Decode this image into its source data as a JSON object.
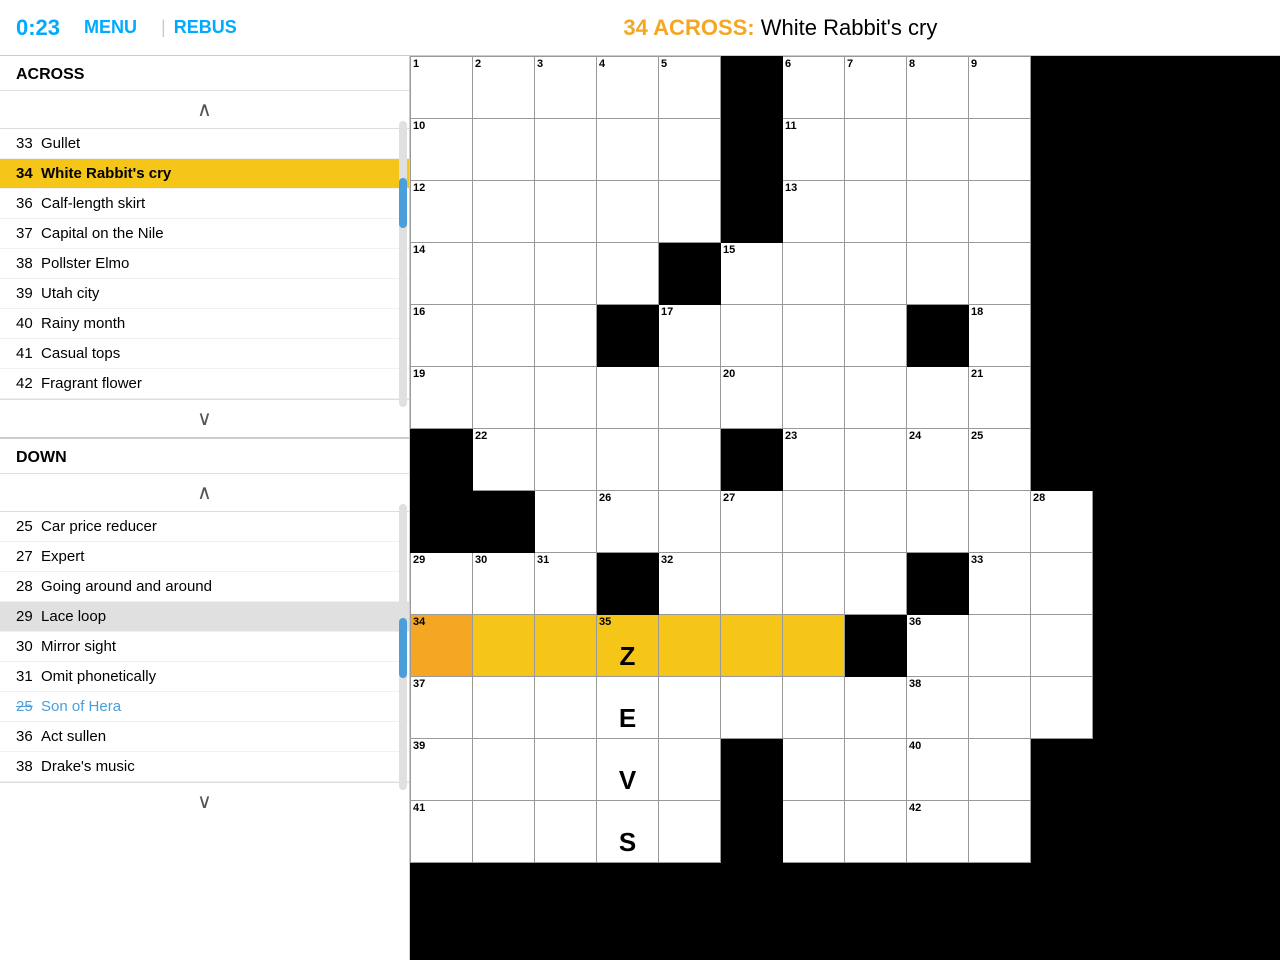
{
  "header": {
    "timer": "0:23",
    "menu": "MENU",
    "rebus": "REBUS",
    "clue_prefix": "34 ACROSS:",
    "clue_text": " White Rabbit's cry"
  },
  "sidebar": {
    "across_label": "ACROSS",
    "down_label": "DOWN",
    "across_clues": [
      {
        "num": "33",
        "text": "Gullet",
        "active": false,
        "highlighted": false
      },
      {
        "num": "34",
        "text": "White Rabbit's cry",
        "active": true,
        "highlighted": false
      },
      {
        "num": "36",
        "text": "Calf-length skirt",
        "active": false,
        "highlighted": false
      },
      {
        "num": "37",
        "text": "Capital on the Nile",
        "active": false,
        "highlighted": false
      },
      {
        "num": "38",
        "text": "Pollster Elmo",
        "active": false,
        "highlighted": false
      },
      {
        "num": "39",
        "text": "Utah city",
        "active": false,
        "highlighted": false
      },
      {
        "num": "40",
        "text": "Rainy month",
        "active": false,
        "highlighted": false
      },
      {
        "num": "41",
        "text": "Casual tops",
        "active": false,
        "highlighted": false
      },
      {
        "num": "42",
        "text": "Fragrant flower",
        "active": false,
        "highlighted": false
      }
    ],
    "down_clues": [
      {
        "num": "25",
        "text": "Car price reducer",
        "active": false,
        "highlighted": false
      },
      {
        "num": "27",
        "text": "Expert",
        "active": false,
        "highlighted": false
      },
      {
        "num": "28",
        "text": "Going around and around",
        "active": false,
        "highlighted": false
      },
      {
        "num": "29",
        "text": "Lace loop",
        "active": false,
        "highlighted": true
      },
      {
        "num": "30",
        "text": "Mirror sight",
        "active": false,
        "highlighted": false
      },
      {
        "num": "31",
        "text": "Omit phonetically",
        "active": false,
        "highlighted": false
      },
      {
        "num": "25b",
        "text": "Son of Hera",
        "active": false,
        "highlighted": false,
        "blue": true
      },
      {
        "num": "36",
        "text": "Act sullen",
        "active": false,
        "highlighted": false
      },
      {
        "num": "38",
        "text": "Drake's music",
        "active": false,
        "highlighted": false
      }
    ]
  },
  "grid": {
    "cells": []
  }
}
